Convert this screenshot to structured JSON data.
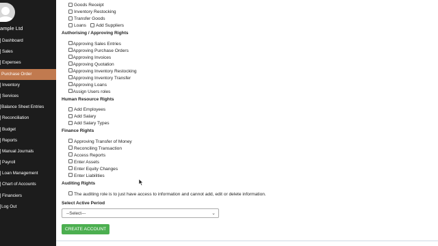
{
  "sidebar": {
    "company": "ample Ltd",
    "items": [
      {
        "label": "Dashboard"
      },
      {
        "label": "Sales"
      },
      {
        "label": "Expenses"
      },
      {
        "label": "Purchase Order"
      },
      {
        "label": "Inventory"
      },
      {
        "label": "Services"
      },
      {
        "label": "Balance Sheet Entries"
      },
      {
        "label": "Reconciliation"
      },
      {
        "label": "Budget"
      },
      {
        "label": "Reports"
      },
      {
        "label": "Manual Journals"
      },
      {
        "label": "Payroll"
      },
      {
        "label": "Loan Management"
      },
      {
        "label": "Chart of Accounts"
      },
      {
        "label": "Financiers"
      },
      {
        "label": "Log Out"
      }
    ],
    "active_item": "Purchase Order"
  },
  "permissions": {
    "top_items": [
      "Goods Receipt",
      "Inventory Restocking",
      "Transfer Goods"
    ],
    "loans": "Loans",
    "add_suppliers": "Add Suppliers",
    "authorising_title": "Authorising / Approving Rights",
    "authorising_items": [
      "Approving Sales Entries",
      "Approving Purchase Orders",
      "Approving Invoices",
      "Approving Quotation",
      "Approving Inventory Restocking",
      "Approving Inventory Transfer",
      "Approving Loans",
      "Assign Users roles"
    ],
    "hr_title": "Human Resource Rights",
    "hr_items": [
      "Add Employees",
      "Add Salary",
      "Add Salary Types"
    ],
    "finance_title": "Finance Rights",
    "finance_items": [
      "Approving Transfer of Money",
      "Reconciling Transaction",
      "Access Reports",
      "Enter Assets",
      "Enter Equity Changes",
      "Enter Liabilities"
    ],
    "auditing_title": "Auditing Rights",
    "auditing_text": "The auditing role is to just have access to information and cannot add, edit or delete information."
  },
  "period": {
    "label": "Select Active Period",
    "selected": "--Select---"
  },
  "create_button": "CREATE ACCOUNT"
}
